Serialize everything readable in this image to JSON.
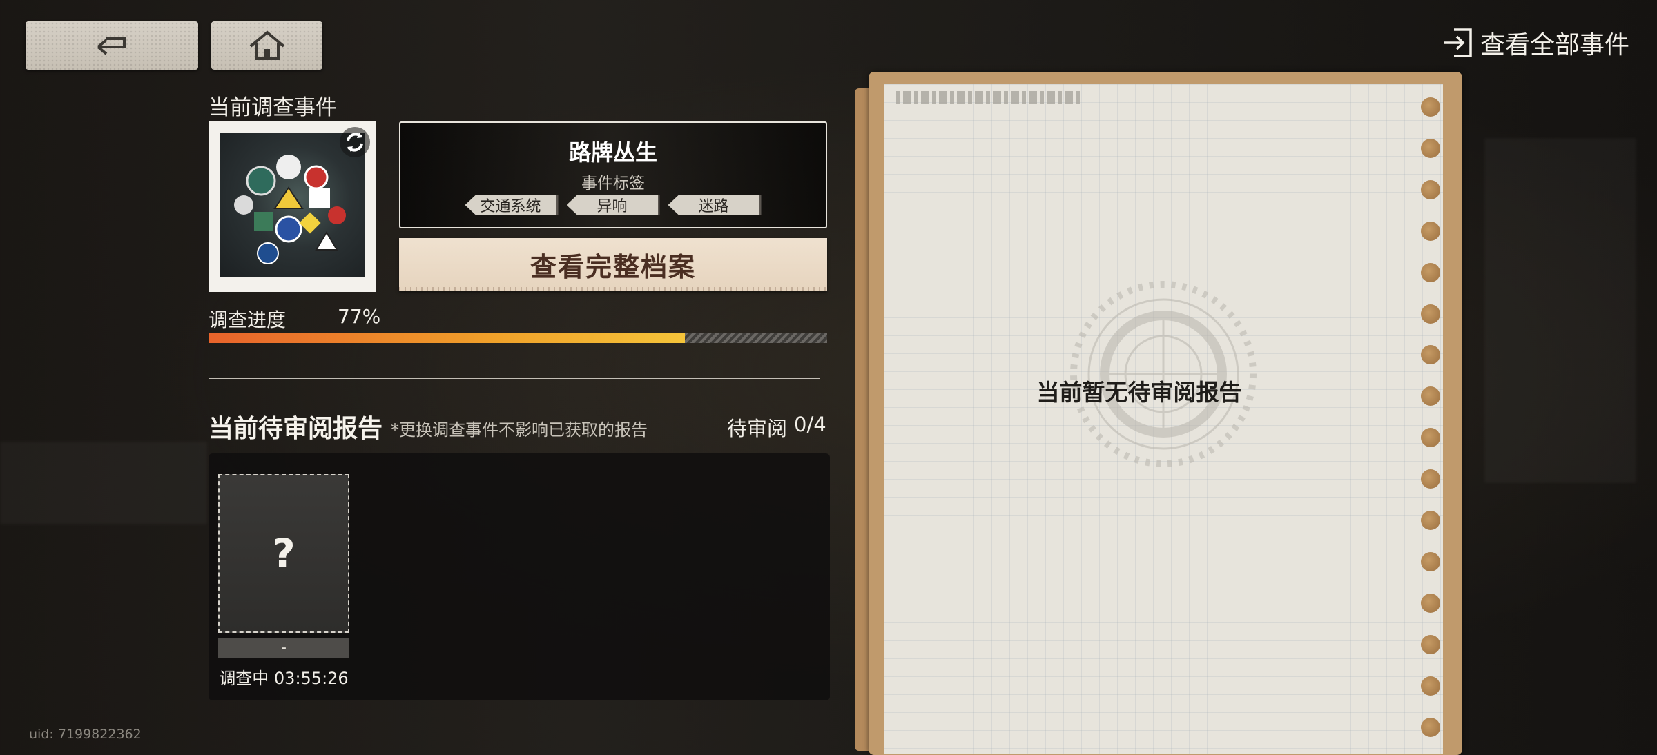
{
  "header": {
    "back_icon": "back-arrow-icon",
    "home_icon": "home-icon",
    "view_all_icon": "exit-icon",
    "view_all_label": "查看全部事件"
  },
  "current_event": {
    "section_title": "当前调查事件",
    "image_icon": "road-signs-cluster",
    "refresh_icon": "refresh-icon",
    "name": "路牌丛生",
    "tags_label": "事件标签",
    "tags": [
      "交通系统",
      "异响",
      "迷路"
    ],
    "full_file_button": "查看完整档案"
  },
  "progress": {
    "label": "调查进度",
    "value_text": "77%",
    "value": 0.77,
    "fill_color": "#f0a12a"
  },
  "pending": {
    "title": "当前待审阅报告",
    "note": "*更换调查事件不影响已获取的报告",
    "count_label": "待审阅",
    "count": "0/4",
    "cards": [
      {
        "slot_symbol": "?",
        "caption": "-",
        "status": "调查中 03:55:26"
      }
    ]
  },
  "notebook": {
    "empty_text": "当前暂无待审阅报告",
    "emblem_icon": "investigation-seal"
  },
  "uid": "uid: 7199822362"
}
